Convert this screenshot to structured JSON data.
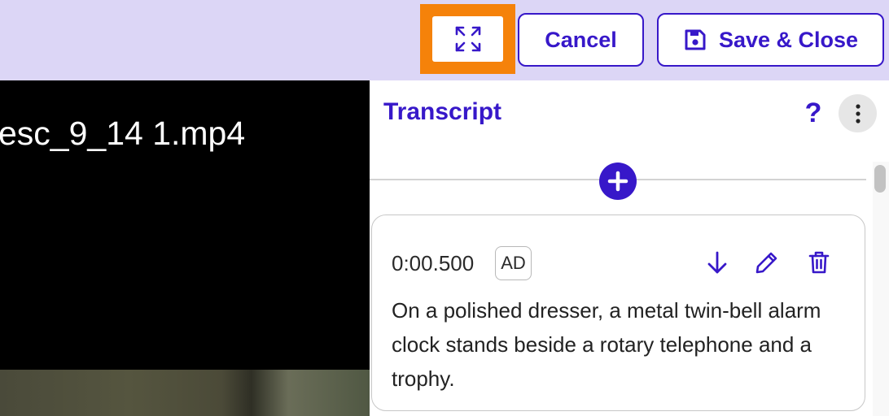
{
  "toolbar": {
    "cancel_label": "Cancel",
    "save_close_label": "Save & Close",
    "highlight_color": "#f5820a",
    "accent_color": "#3718c9"
  },
  "video": {
    "title": "esc_9_14 1.mp4"
  },
  "panel": {
    "title": "Transcript",
    "help_label": "?"
  },
  "entry": {
    "timestamp": "0:00.500",
    "badge": "AD",
    "text": "On a polished dresser, a metal twin-bell alarm clock stands beside a rotary telephone and a trophy."
  },
  "icons": {
    "expand": "fullscreen-icon",
    "save": "floppy-disk-icon",
    "more": "vertical-dots-icon",
    "add": "plus-icon",
    "move_down": "arrow-down-icon",
    "edit": "pencil-icon",
    "delete": "trash-icon"
  }
}
